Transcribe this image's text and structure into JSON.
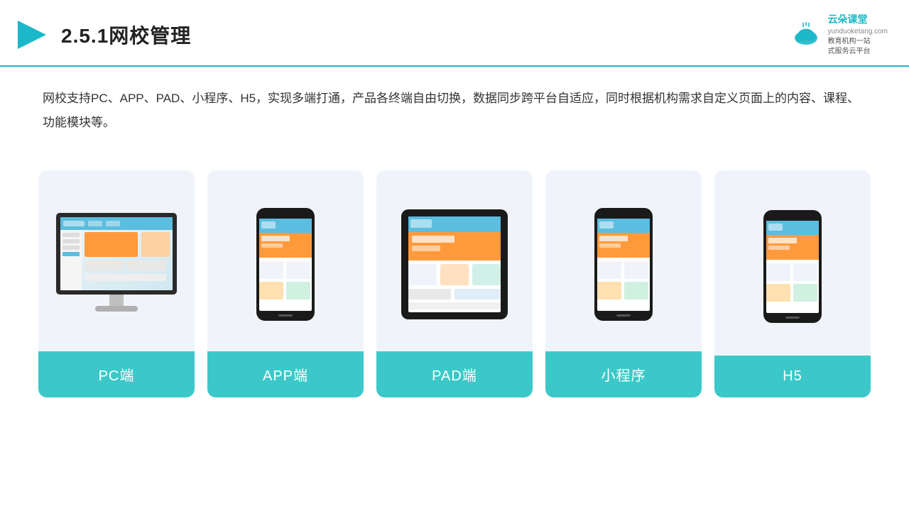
{
  "header": {
    "title": "2.5.1网校管理",
    "brand": {
      "name": "云朵课堂",
      "domain": "yunduoketang.com",
      "tagline": "教育机构一站",
      "tagline2": "式服务云平台"
    }
  },
  "description": {
    "text": "网校支持PC、APP、PAD、小程序、H5，实现多端打通，产品各终端自由切换，数据同步跨平台自适应，同时根据机构需求自定义页面上的内容、课程、功能模块等。"
  },
  "cards": [
    {
      "id": "pc",
      "label": "PC端",
      "type": "pc"
    },
    {
      "id": "app",
      "label": "APP端",
      "type": "phone"
    },
    {
      "id": "pad",
      "label": "PAD端",
      "type": "pad"
    },
    {
      "id": "miniprogram",
      "label": "小程序",
      "type": "phone"
    },
    {
      "id": "h5",
      "label": "H5",
      "type": "phone"
    }
  ]
}
